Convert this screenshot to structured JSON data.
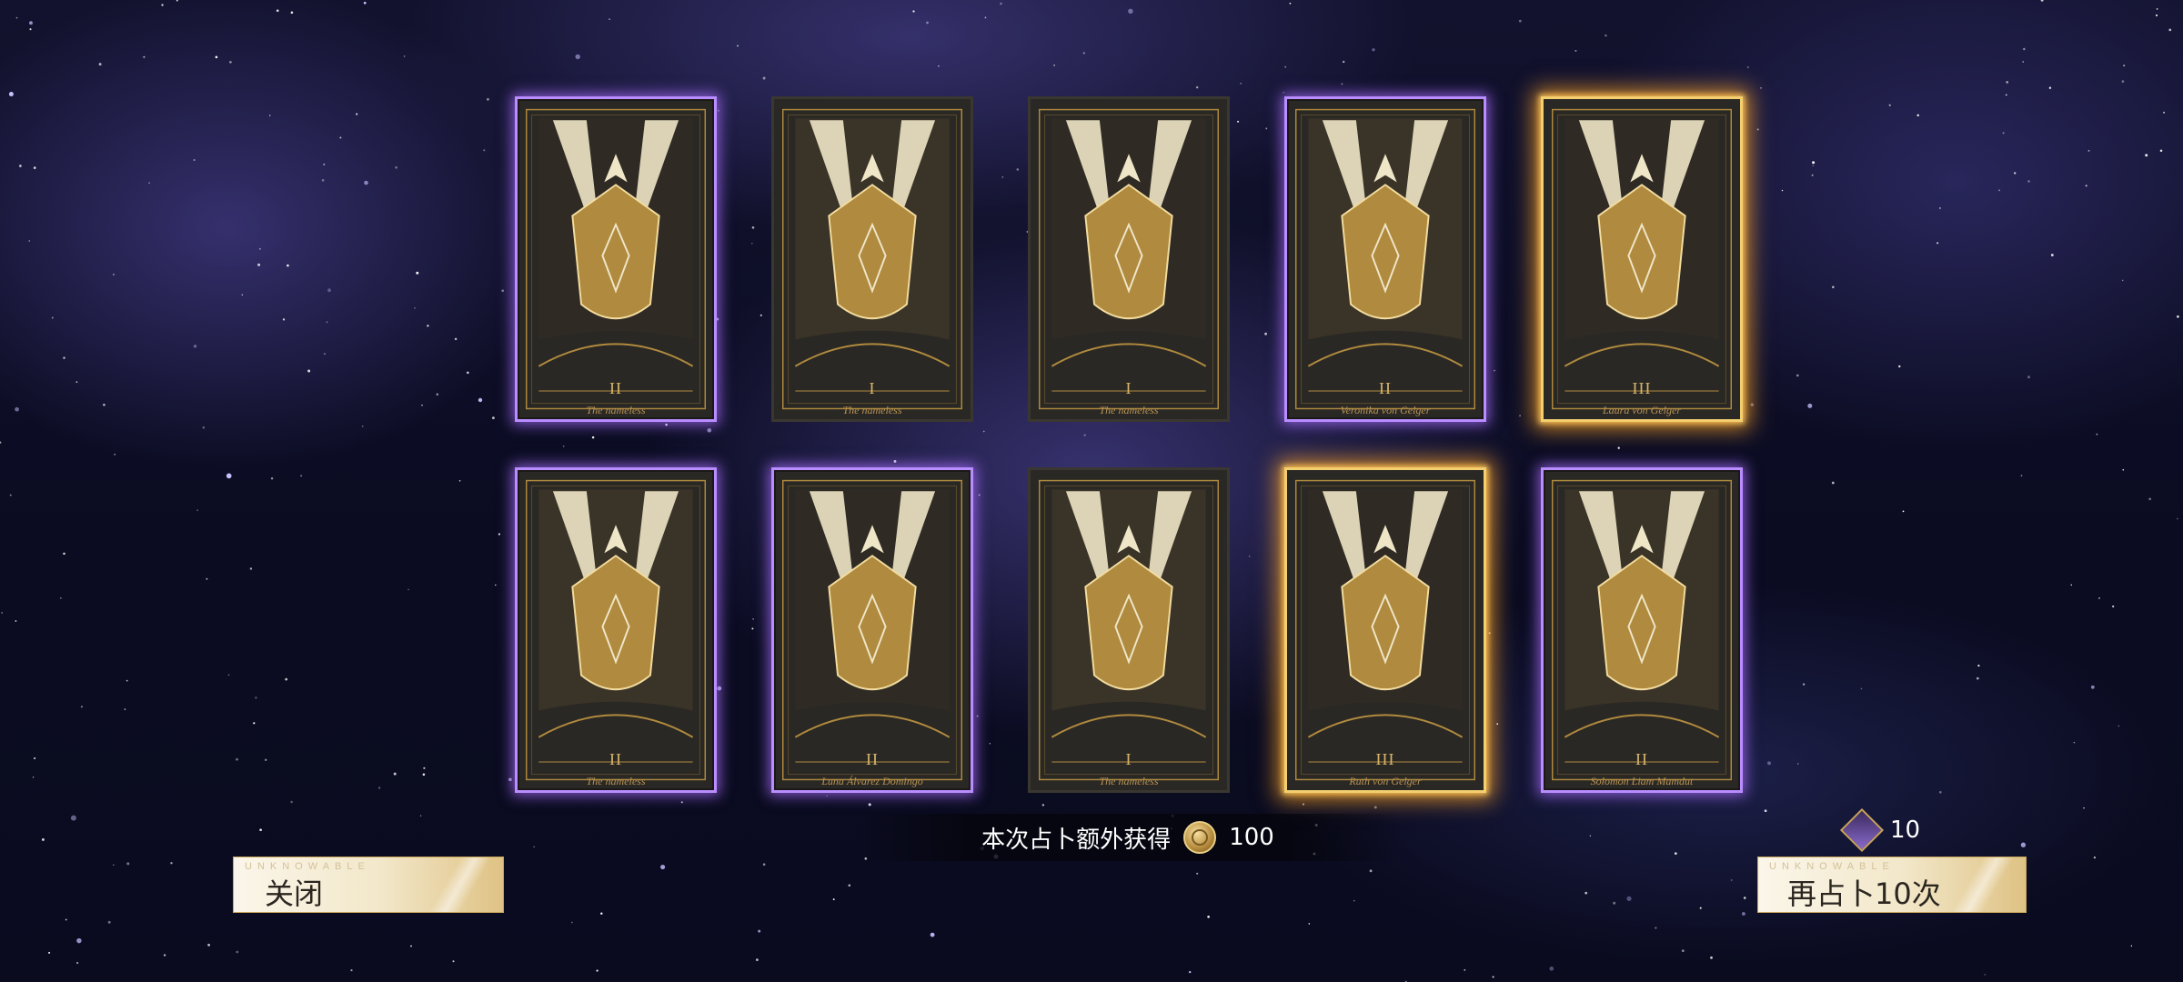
{
  "cards": [
    {
      "numeral": "II",
      "name": "The nameless",
      "frame": "purple"
    },
    {
      "numeral": "I",
      "name": "The nameless",
      "frame": "plain"
    },
    {
      "numeral": "I",
      "name": "The nameless",
      "frame": "plain"
    },
    {
      "numeral": "II",
      "name": "Veronika von Gelger",
      "frame": "purple"
    },
    {
      "numeral": "III",
      "name": "Laura von Gelger",
      "frame": "gold"
    },
    {
      "numeral": "II",
      "name": "The nameless",
      "frame": "purple"
    },
    {
      "numeral": "II",
      "name": "Luna Álvarez Domingo",
      "frame": "purple"
    },
    {
      "numeral": "I",
      "name": "The nameless",
      "frame": "plain"
    },
    {
      "numeral": "III",
      "name": "Ruth von Gelger",
      "frame": "gold"
    },
    {
      "numeral": "II",
      "name": "Solomon Liam Mamdut",
      "frame": "purple"
    }
  ],
  "bonus": {
    "label": "本次占卜额外获得",
    "amount": "100",
    "icon": "coin-icon"
  },
  "close_button": {
    "label": "关闭",
    "watermark": "UNKNOWABLE"
  },
  "redraw_button": {
    "label": "再占卜10次",
    "watermark": "UNKNOWABLE"
  },
  "cost": {
    "amount": "10",
    "icon": "divination-gem-icon"
  },
  "colors": {
    "purple_frame": "#b98dff",
    "gold_frame": "#f3cf6f",
    "card_gold": "#b08a3e",
    "card_cream": "#efe6c8"
  }
}
